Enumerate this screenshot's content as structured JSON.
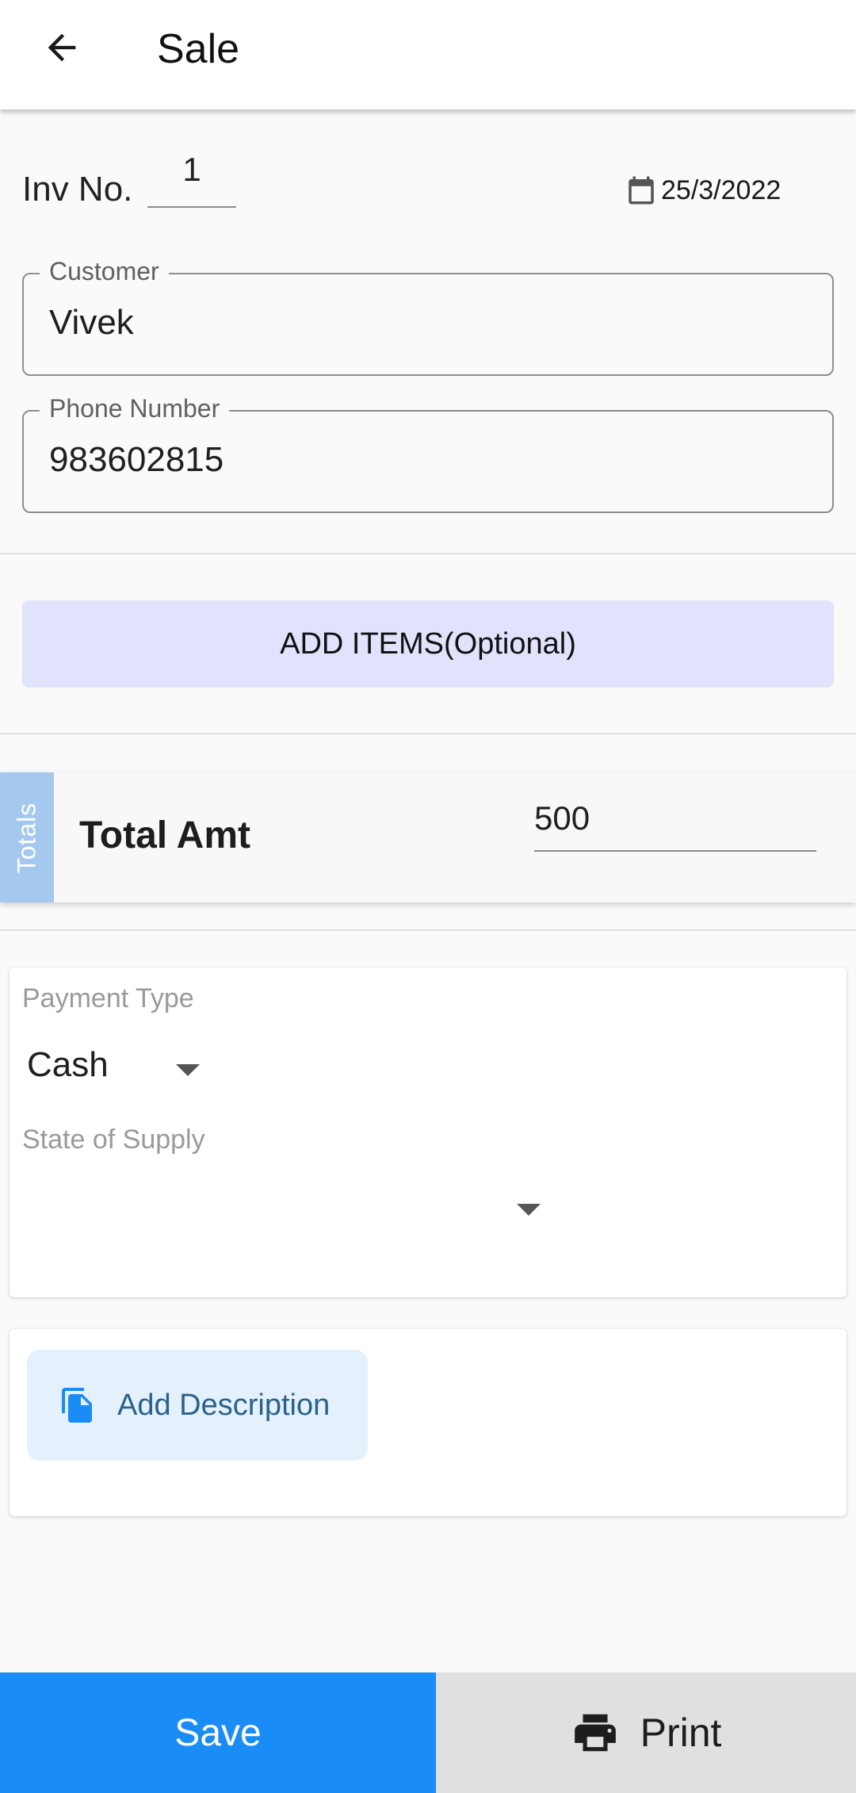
{
  "header": {
    "title": "Sale",
    "back_icon": "arrow-left-icon"
  },
  "invoice": {
    "label": "Inv No.",
    "number": "1",
    "date": "25/3/2022",
    "date_icon": "calendar-icon"
  },
  "customer": {
    "label": "Customer",
    "value": "Vivek"
  },
  "phone": {
    "label": "Phone Number",
    "value": "983602815"
  },
  "add_items": {
    "label": "ADD ITEMS(Optional)"
  },
  "totals": {
    "tab_label": "Totals",
    "label": "Total Amt",
    "value": "500"
  },
  "payment": {
    "type_label": "Payment Type",
    "type_value": "Cash",
    "state_label": "State of Supply",
    "state_value": ""
  },
  "description": {
    "label": "Add Description",
    "icon": "document-icon"
  },
  "actions": {
    "save_label": "Save",
    "print_label": "Print",
    "print_icon": "printer-icon"
  },
  "colors": {
    "primary": "#1a8cf5",
    "add_items_bg": "#e1e3fd",
    "totals_tab": "#a5c8ee",
    "description_bg": "#e4f1fd",
    "description_text": "#2b6288"
  }
}
